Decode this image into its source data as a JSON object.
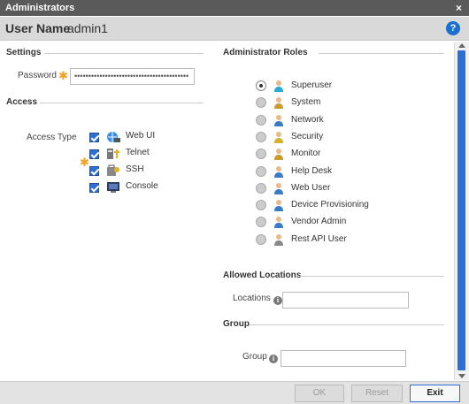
{
  "window": {
    "title": "Administrators",
    "close_glyph": "×"
  },
  "userbar": {
    "label": "User Name",
    "value": "admin1",
    "help_glyph": "?"
  },
  "settings": {
    "title": "Settings",
    "password_label": "Password",
    "password_value": "•••••••••••••••••••••••••••••••••••••••••"
  },
  "access": {
    "title": "Access",
    "type_label": "Access Type",
    "items": [
      {
        "label": "Web UI",
        "checked": true,
        "icon": "web-ui-icon"
      },
      {
        "label": "Telnet",
        "checked": true,
        "icon": "telnet-icon"
      },
      {
        "label": "SSH",
        "checked": true,
        "icon": "ssh-icon"
      },
      {
        "label": "Console",
        "checked": true,
        "icon": "console-icon"
      }
    ]
  },
  "roles": {
    "title": "Administrator Roles",
    "items": [
      {
        "label": "Superuser",
        "selected": true
      },
      {
        "label": "System",
        "selected": false
      },
      {
        "label": "Network",
        "selected": false
      },
      {
        "label": "Security",
        "selected": false
      },
      {
        "label": "Monitor",
        "selected": false
      },
      {
        "label": "Help Desk",
        "selected": false
      },
      {
        "label": "Web User",
        "selected": false
      },
      {
        "label": "Device Provisioning",
        "selected": false
      },
      {
        "label": "Vendor Admin",
        "selected": false
      },
      {
        "label": "Rest API User",
        "selected": false
      }
    ]
  },
  "allowed_locations": {
    "title": "Allowed Locations",
    "label": "Locations",
    "value": ""
  },
  "group": {
    "title": "Group",
    "label": "Group",
    "value": ""
  },
  "footer": {
    "ok": "OK",
    "reset": "Reset",
    "exit": "Exit"
  },
  "colors": {
    "accent": "#2e6fd6",
    "required": "#f5a020",
    "titlebar": "#5a5a5a"
  }
}
